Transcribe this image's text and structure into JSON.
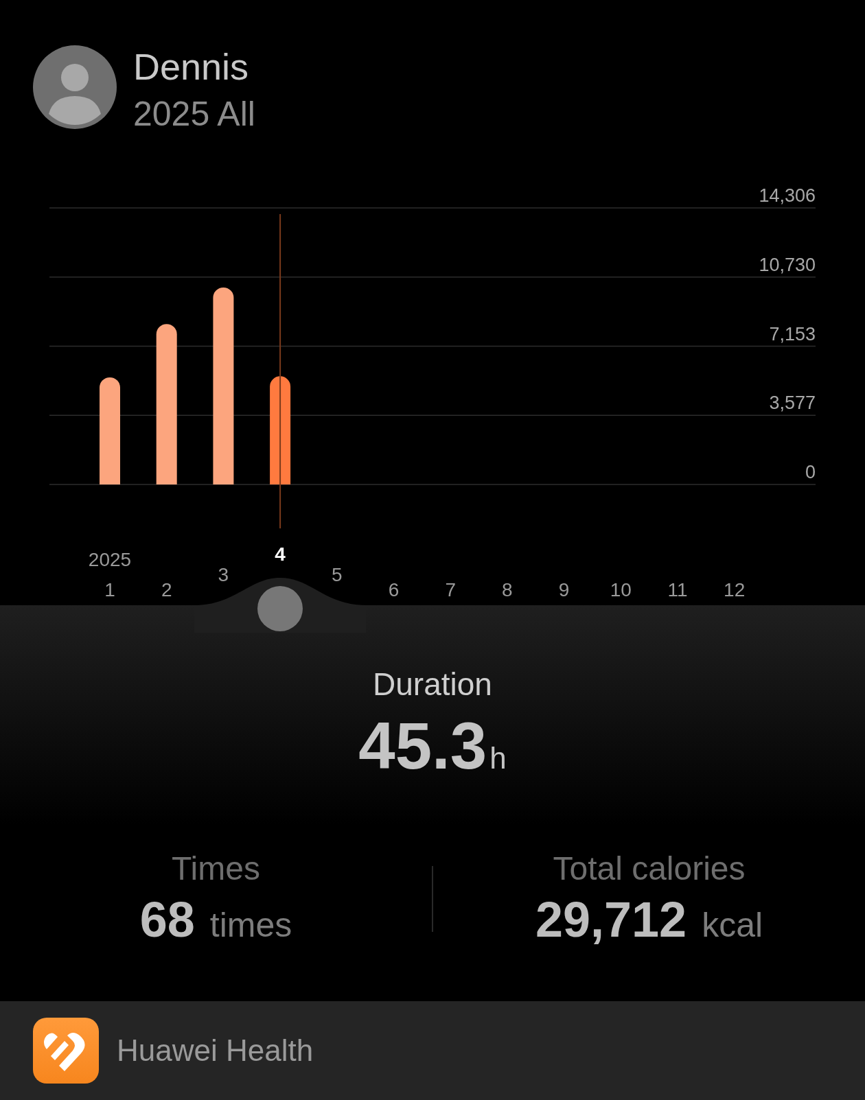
{
  "profile": {
    "name": "Dennis",
    "period": "2025 All"
  },
  "chart": {
    "chart_data": {
      "type": "bar",
      "grid": true,
      "values": [
        5540,
        8300,
        10190,
        5600,
        null,
        null,
        null,
        null,
        null,
        null,
        null,
        null
      ],
      "ylim": [
        0,
        14306
      ],
      "yticks": [
        {
          "value": 0,
          "label": "0"
        },
        {
          "value": 3577,
          "label": "3,577"
        },
        {
          "value": 7153,
          "label": "7,153"
        },
        {
          "value": 10730,
          "label": "10,730"
        },
        {
          "value": 14306,
          "label": "14,306"
        }
      ]
    }
  },
  "month_selector": {
    "year_label": "2025",
    "months": [
      {
        "label": "1",
        "selected": false
      },
      {
        "label": "2",
        "selected": false
      },
      {
        "label": "3",
        "selected": false
      },
      {
        "label": "4",
        "selected": true
      },
      {
        "label": "5",
        "selected": false
      },
      {
        "label": "6",
        "selected": false
      },
      {
        "label": "7",
        "selected": false
      },
      {
        "label": "8",
        "selected": false
      },
      {
        "label": "9",
        "selected": false
      },
      {
        "label": "10",
        "selected": false
      },
      {
        "label": "11",
        "selected": false
      },
      {
        "label": "12",
        "selected": false
      }
    ]
  },
  "summary": {
    "label": "Duration",
    "value": "45.3",
    "unit": "h"
  },
  "stats": [
    {
      "label": "Times",
      "value": "68",
      "unit": "times"
    },
    {
      "label": "Total calories",
      "value": "29,712",
      "unit": "kcal"
    }
  ],
  "app_bar": {
    "name": "Huawei Health"
  }
}
